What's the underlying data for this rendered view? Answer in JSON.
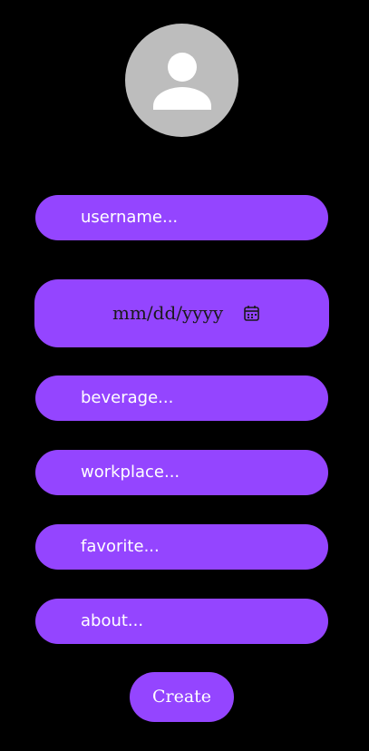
{
  "colors": {
    "background": "#000000",
    "accent": "#9445ff",
    "avatar_bg": "#bdbdbd",
    "text_light": "#ffffff",
    "text_dark": "#1a1a1a"
  },
  "avatar": {
    "icon": "person-icon"
  },
  "form": {
    "username": {
      "placeholder": "username...",
      "value": ""
    },
    "birthdate": {
      "placeholder": "mm/dd/yyyy",
      "icon": "calendar-icon"
    },
    "beverage": {
      "placeholder": "beverage...",
      "value": ""
    },
    "workplace": {
      "placeholder": "workplace...",
      "value": ""
    },
    "favorite": {
      "placeholder": "favorite...",
      "value": ""
    },
    "about": {
      "placeholder": "about...",
      "value": ""
    },
    "submit_label": "Create"
  }
}
